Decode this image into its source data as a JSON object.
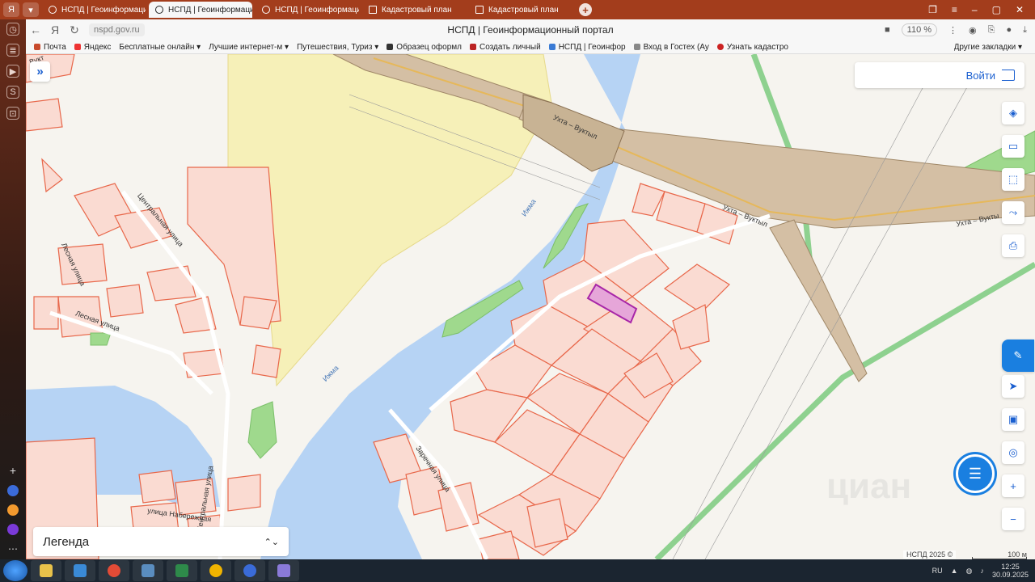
{
  "browser": {
    "tabs": [
      {
        "label": "НСПД | Геоинформацион",
        "active": false
      },
      {
        "label": "НСПД | Геоинформаци",
        "active": true
      },
      {
        "label": "НСПД | Геоинформацион",
        "active": false
      },
      {
        "label": "Кадастровый план",
        "active": false
      },
      {
        "label": "Кадастровый план",
        "active": false
      }
    ],
    "tab_close": "×",
    "new_tab": "+",
    "yandex_badge": "Войти",
    "url": "nspd.gov.ru",
    "page_title": "НСПД | Геоинформационный портал",
    "zoom": "110 %",
    "bookmarks": [
      "Почта",
      "Яндекс",
      "Бесплатные онлайн",
      "Лучшие интернет-м",
      "Путешествия, Туриз",
      "Образец оформл",
      "Создать личный",
      "НСПД | Геоинфор",
      "Вход в Гостех (Ау",
      "Узнать кадастро"
    ],
    "other_bookmarks": "Другие закладки"
  },
  "map": {
    "login_label": "Войти",
    "legend_label": "Легенда",
    "attribution": "НСПД 2025 ©",
    "scale_label": "100 м",
    "watermark": "циан",
    "labels": {
      "road_top": "Ухта – Вуктыл",
      "road_mid": "Ухта – Вуктыл",
      "road_right": "Ухта – Вукты",
      "river_1": "Ижма",
      "river_2": "Ижма",
      "street_central": "Центральная улица",
      "street_forest": "Лесная улица",
      "street_lesnaya2": "Лесная улица",
      "street_zarechnaya": "Заречная улица",
      "street_central2": "Центральная улица",
      "street_embankment": "улица Набережная",
      "road_top_left": "Вукт"
    },
    "colors": {
      "parcel_fill": "#fadbd2",
      "parcel_stroke": "#e8674a",
      "selected_fill": "#e6a6d9",
      "selected_stroke": "#a826a8",
      "river": "#b6d3f4",
      "forest_zone": "#f6f0b8",
      "road": "#d4bfa4",
      "green": "#9fd98d",
      "accent": "#1a5fd0"
    }
  },
  "taskbar": {
    "lang": "RU",
    "time": "12:25",
    "date": "30.09.2025"
  }
}
